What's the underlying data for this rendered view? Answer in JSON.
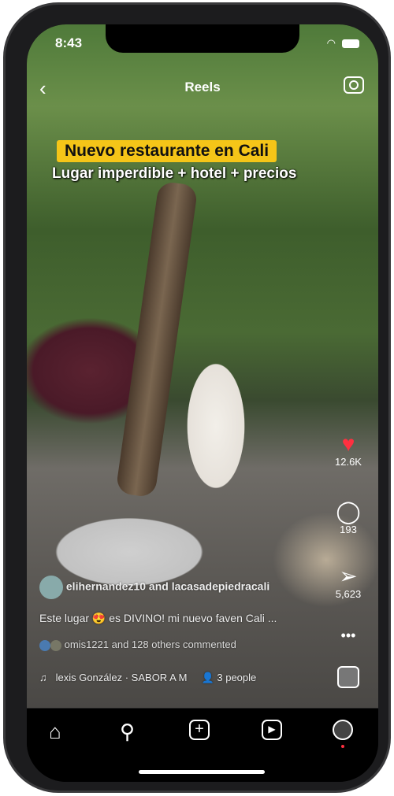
{
  "status": {
    "time": "8:43"
  },
  "header": {
    "title": "Reels",
    "back_icon": "chevron-left-icon",
    "camera_icon": "camera-icon"
  },
  "video": {
    "caption_title": "Nuevo restaurante en Cali",
    "caption_subtitle": "Lugar imperdible + hotel + precios"
  },
  "actions": {
    "likes": "12.6K",
    "comments": "193",
    "shares": "5,623",
    "like_color": "#ff3040"
  },
  "post": {
    "authors": "elihernandez10 and lacasadepiedracali",
    "caption": "Este lugar 😍 es DIVINO! mi nuevo faven Cali ...",
    "commented": "omis1221 and 128 others commented",
    "audio": "lexis González · SABOR A M",
    "people": "3 people"
  },
  "nav": {
    "items": [
      "home",
      "search",
      "create",
      "reels",
      "profile"
    ]
  }
}
